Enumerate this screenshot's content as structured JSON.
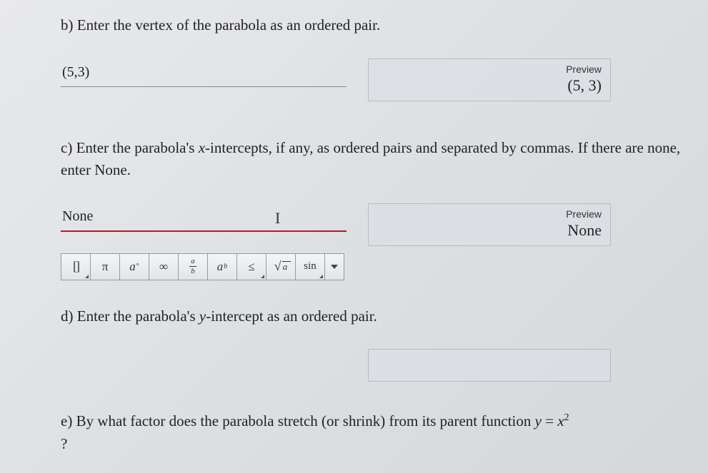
{
  "q_b": {
    "label": "b)",
    "prompt": "Enter the vertex of the parabola as an ordered pair.",
    "input_value": "(5,3)",
    "preview_label": "Preview",
    "preview_value": "(5, 3)"
  },
  "q_c": {
    "label": "c)",
    "prompt_part1": "Enter the parabola's ",
    "prompt_var": "x",
    "prompt_part2": "-intercepts, if any, as ordered pairs and separated by commas. If there are none, enter ",
    "prompt_none": "None",
    "prompt_part3": ".",
    "input_value": "None",
    "cursor": "I",
    "preview_label": "Preview",
    "preview_value": "None"
  },
  "toolbar": {
    "brackets": "[]",
    "pi": "π",
    "deg_base": "a",
    "deg_sup": "°",
    "infinity": "∞",
    "frac_top": "a",
    "frac_bot": "b",
    "pow_base": "a",
    "pow_sup": "b",
    "leq": "≤",
    "sqrt": "√",
    "sqrt_a": "a",
    "sin": "sin"
  },
  "q_d": {
    "label": "d)",
    "prompt_part1": "Enter the parabola's ",
    "prompt_var": "y",
    "prompt_part2": "-intercept as an ordered pair."
  },
  "q_e": {
    "label": "e)",
    "prompt_part1": "By what factor does the parabola stretch (or shrink) from its parent function ",
    "prompt_fn_y": "y",
    "prompt_fn_eq": " = ",
    "prompt_fn_x": "x",
    "prompt_fn_exp": "2",
    "prompt_part2": "?"
  }
}
